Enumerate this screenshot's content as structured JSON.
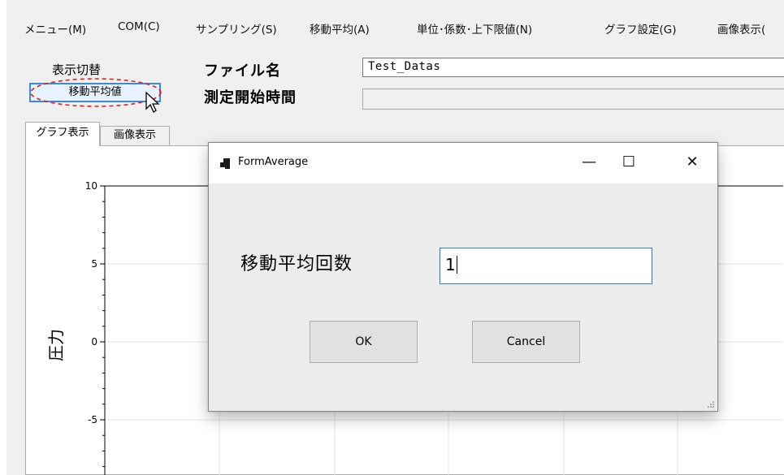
{
  "menu": {
    "items": [
      {
        "label": "メニュー(M)"
      },
      {
        "label": "COM(C)"
      },
      {
        "label": "サンプリング(S)"
      },
      {
        "label": "移動平均(A)"
      },
      {
        "label": "単位･係数･上下限値(N)"
      },
      {
        "label": "グラフ設定(G)"
      },
      {
        "label": "画像表示("
      }
    ]
  },
  "controls": {
    "switch_label": "表示切替",
    "average_button": "移動平均値",
    "filename_label": "ファイル名",
    "filename_value": "Test_Datas",
    "start_time_label": "測定開始時間",
    "start_time_value": ""
  },
  "tabs": {
    "graph": "グラフ表示",
    "image": "画像表示"
  },
  "chart_data": {
    "type": "line",
    "title": "",
    "ylabel": "圧力",
    "xlabel": "",
    "ylim": [
      -5,
      10
    ],
    "yticks": [
      "10",
      "5",
      "0",
      "-5"
    ],
    "grid": true,
    "series": []
  },
  "dialog": {
    "title": "FormAverage",
    "field_label": "移動平均回数",
    "field_value": "1",
    "ok_label": "OK",
    "cancel_label": "Cancel",
    "minimize_glyph": "—",
    "maximize_glyph": "☐",
    "close_glyph": "✕"
  },
  "colors": {
    "focus_blue": "#2d7bd2",
    "highlight_ellipse": "#e02020"
  }
}
